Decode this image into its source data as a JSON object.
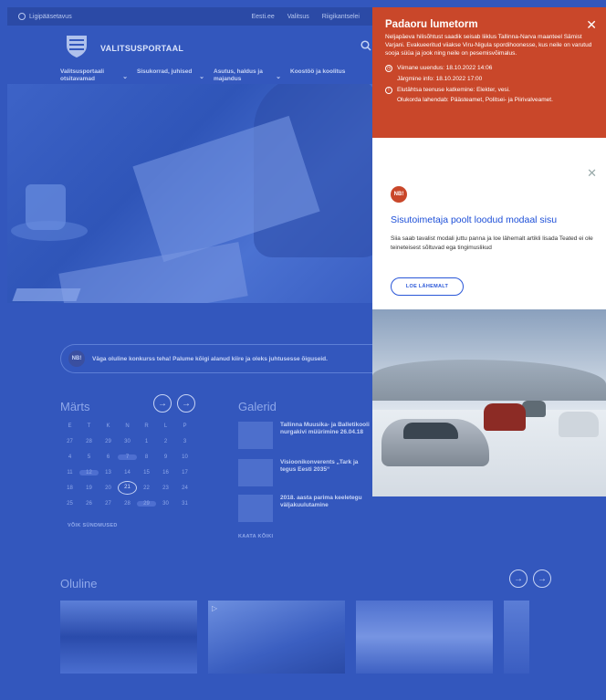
{
  "topbar": {
    "language": "Ligipääsetavus",
    "links": [
      "Eesti.ee",
      "Valitsus",
      "Riigikantselei"
    ]
  },
  "header": {
    "logo_text": "Valitsusportaal"
  },
  "mainnav": {
    "items": [
      "Valitsusportaali otsitavamad",
      "Sisukorrad, juhised",
      "Asutus, haldus ja majandus",
      "Koostöö ja koolitus"
    ]
  },
  "notice": {
    "badge": "NB!",
    "text": "Väga oluline konkurss teha! Palume kõigi alanud kiire ja oleks juhtusesse õiguseid."
  },
  "calendar": {
    "title": "Märts",
    "weekdays": [
      "E",
      "T",
      "K",
      "N",
      "R",
      "L",
      "P"
    ],
    "weeks": [
      [
        "27",
        "28",
        "29",
        "30",
        "1",
        "2",
        "3"
      ],
      [
        "4",
        "5",
        "6",
        "7",
        "8",
        "9",
        "10"
      ],
      [
        "11",
        "12",
        "13",
        "14",
        "15",
        "16",
        "17"
      ],
      [
        "18",
        "19",
        "20",
        "21",
        "22",
        "23",
        "24"
      ],
      [
        "25",
        "26",
        "27",
        "28",
        "29",
        "30",
        "31"
      ]
    ],
    "more": "VÕIK SÜNDMUSED"
  },
  "galleries": {
    "title": "Galerid",
    "items": [
      "Tallinna Muusika- ja Balletikooli nurgakivi müürimine 26.04.18",
      "Visioonikonverents „Tark ja tegus Eesti 2035“",
      "2018. aasta parima keeletegu väljakuulutamine"
    ],
    "more": "KAATA KÕIKI"
  },
  "oluline": {
    "title": "Oluline"
  },
  "alert": {
    "title": "Padaoru lumetorm",
    "body": "Neljapäeva hilisõhtust saadik seisab liiklus Tallinna-Narva maanteel Sämist Varjani. Evakueeritud viiakse Viru-Nigula spordihoonesse, kus neile on varutud sooja süüa ja jook ning neile on pesemisvõimalus.",
    "updated": "Viimane uuendus: 18.10.2022 14:06",
    "next_info": "Järgmine info: 18.10.2022 17:00",
    "services": "Elutähtsa teenuse katkemine: Elekter, vesi.",
    "resolvers": "Olukorda lahendab: Päästeamet, Politsei- ja Piirivalveamet."
  },
  "modal": {
    "badge": "NB!",
    "title": "Sisutoimetaja poolt loodud modaal sisu",
    "text": "Siia saab tavalist modali juttu panna ja loe lähemalt artikli lisada Teated ei ole teineteisest sõltuvad ega tingimuslikud",
    "button": "LOE LÄHEMALT"
  },
  "colors": {
    "overlay_blue": "#3357bd",
    "alert_red": "#c9472a",
    "link_blue": "#1d4fd8"
  }
}
